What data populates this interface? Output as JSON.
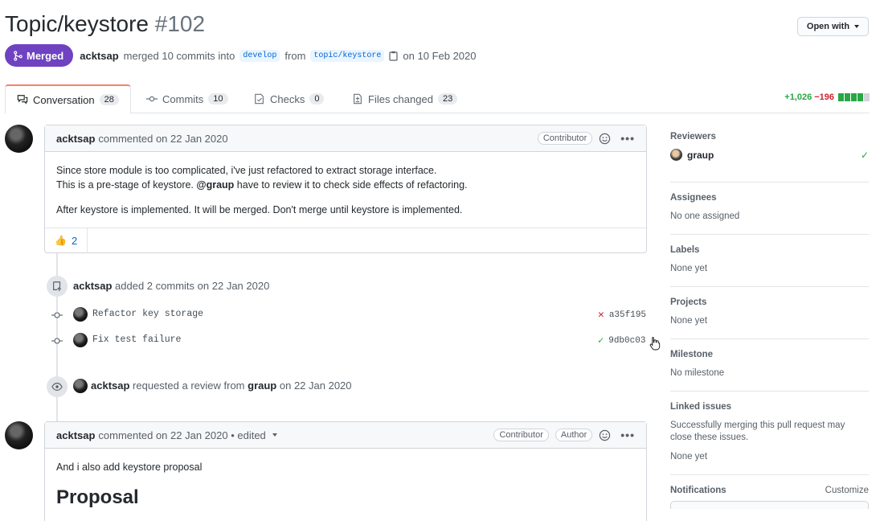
{
  "header": {
    "title": "Topic/keystore",
    "number": "#102",
    "open_with_label": "Open with",
    "state_label": "Merged",
    "author": "acktsap",
    "merged_text": "merged 10 commits into",
    "base_branch": "develop",
    "from_text": "from",
    "head_branch": "topic/keystore",
    "date_text": "on 10 Feb 2020"
  },
  "tabs": [
    {
      "label": "Conversation",
      "count": "28",
      "icon": "comment-discussion-icon"
    },
    {
      "label": "Commits",
      "count": "10",
      "icon": "git-commit-icon"
    },
    {
      "label": "Checks",
      "count": "0",
      "icon": "checklist-icon"
    },
    {
      "label": "Files changed",
      "count": "23",
      "icon": "file-diff-icon"
    }
  ],
  "diffstat": {
    "additions": "+1,026",
    "deletions": "−196",
    "colors": {
      "add": "#28a745",
      "del": "#cb2431",
      "neutral": "#d1d5da"
    }
  },
  "comment1": {
    "author": "acktsap",
    "meta": "commented on 22 Jan 2020",
    "role_badge": "Contributor",
    "line1": "Since store module is too complicated, i've just refactored to extract storage interface.",
    "line2_pre": "This is a pre-stage of keystore.",
    "mention": "@graup",
    "line2_post": "have to review it to check side effects of refactoring.",
    "line3": "After keystore is implemented. It will be merged. Don't merge until keystore is implemented.",
    "reaction_emoji": "👍",
    "reaction_count": "2"
  },
  "commits_event": {
    "author": "acktsap",
    "text": "added 2 commits",
    "date": "on 22 Jan 2020",
    "commits": [
      {
        "message": "Refactor key storage",
        "sha": "a35f195",
        "status": "failure"
      },
      {
        "message": "Fix test failure",
        "sha": "9db0c03",
        "status": "success"
      }
    ]
  },
  "review_event": {
    "author": "acktsap",
    "text": "requested a review from",
    "reviewer": "graup",
    "date": "on 22 Jan 2020"
  },
  "comment2": {
    "author": "acktsap",
    "meta": "commented on 22 Jan 2020 • edited",
    "role_badge": "Contributor",
    "author_badge": "Author",
    "body": "And i also add keystore proposal",
    "heading": "Proposal"
  },
  "sidebar": {
    "reviewers_title": "Reviewers",
    "reviewer_name": "graup",
    "assignees_title": "Assignees",
    "assignees_value": "No one assigned",
    "labels_title": "Labels",
    "labels_value": "None yet",
    "projects_title": "Projects",
    "projects_value": "None yet",
    "milestone_title": "Milestone",
    "milestone_value": "No milestone",
    "linked_title": "Linked issues",
    "linked_desc": "Successfully merging this pull request may close these issues.",
    "linked_value": "None yet",
    "notifications_title": "Notifications",
    "customize_label": "Customize"
  }
}
